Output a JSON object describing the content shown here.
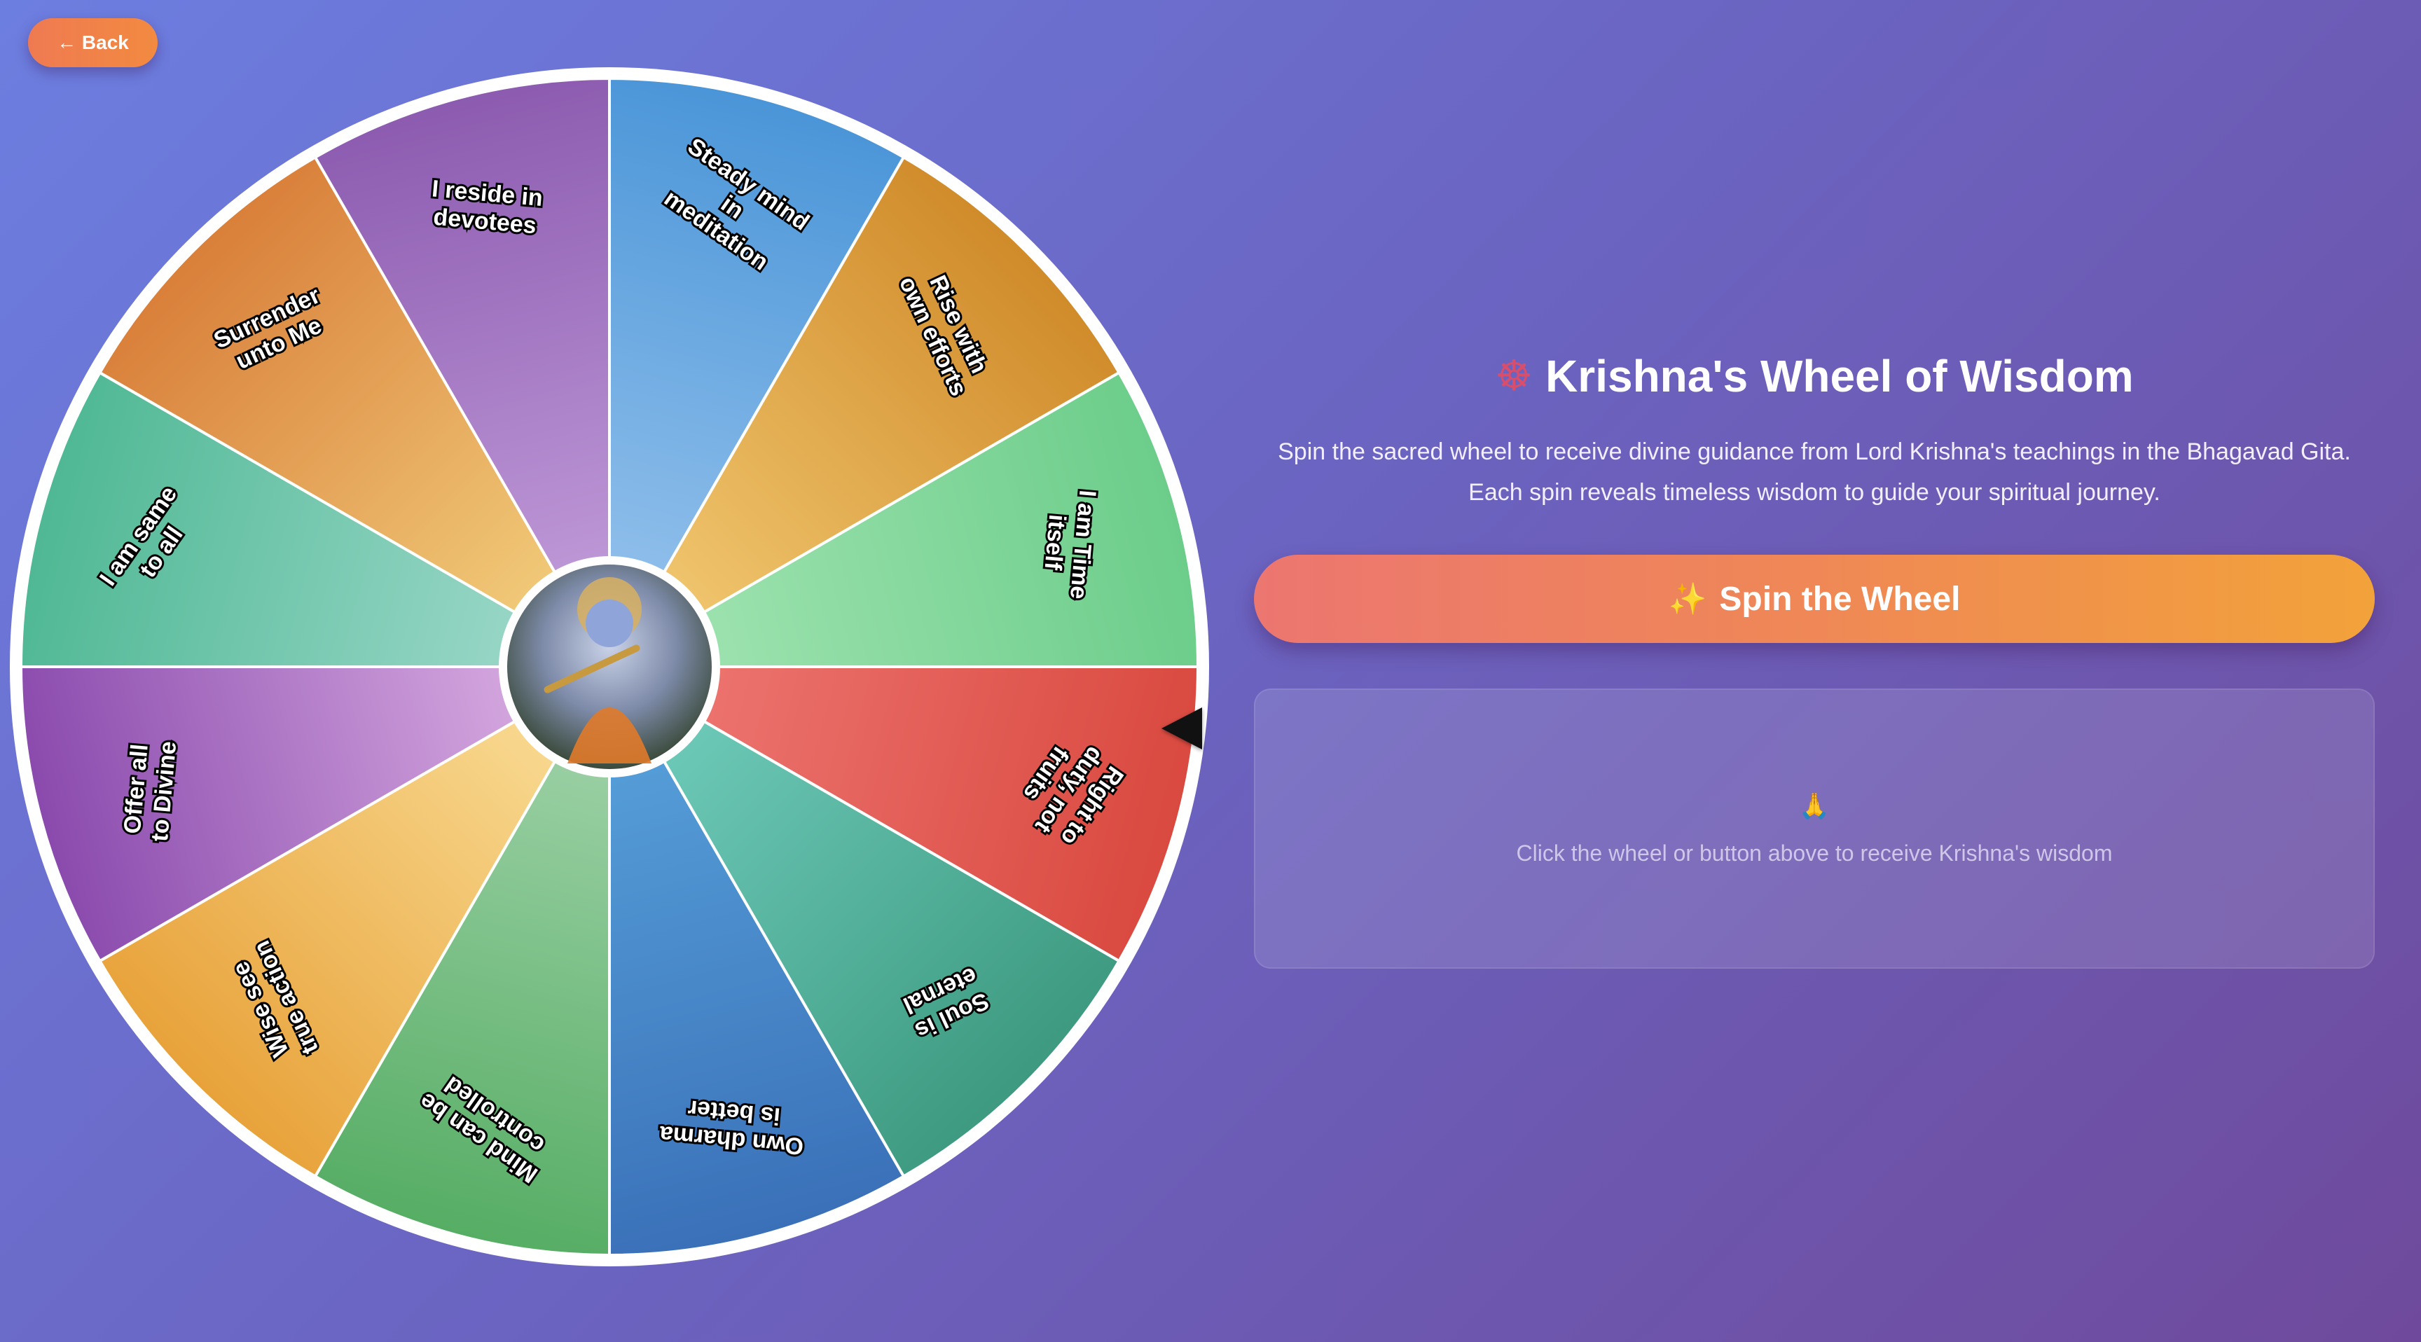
{
  "nav": {
    "back_label": "← Back"
  },
  "wheel": {
    "center_image": "krishna-portrait",
    "segments": [
      {
        "label": "Steady mind in meditation",
        "color_start": "#9cc6ee",
        "color_end": "#4a95d8"
      },
      {
        "label": "Rise with own efforts",
        "color_start": "#f6d07a",
        "color_end": "#d08b2a"
      },
      {
        "label": "I am Time itself",
        "color_start": "#a6e6b6",
        "color_end": "#6ccd8a"
      },
      {
        "label": "Right to duty, not fruits",
        "color_start": "#f07b78",
        "color_end": "#d9493f"
      },
      {
        "label": "Soul is eternal",
        "color_start": "#76d2c2",
        "color_end": "#3d9a80"
      },
      {
        "label": "Own dharma is better",
        "color_start": "#5aa6de",
        "color_end": "#3a70b8"
      },
      {
        "label": "Mind can be controlled",
        "color_start": "#a7d6b0",
        "color_end": "#56ad64"
      },
      {
        "label": "Wise see true action",
        "color_start": "#fbe3a0",
        "color_end": "#e8a23a"
      },
      {
        "label": "Offer all to Divine",
        "color_start": "#e2b8e8",
        "color_end": "#8a4aad"
      },
      {
        "label": "I am same to all",
        "color_start": "#a6dcd0",
        "color_end": "#4fb894"
      },
      {
        "label": "Surrender unto Me",
        "color_start": "#f5d884",
        "color_end": "#d97f3a"
      },
      {
        "label": "I reside in devotees",
        "color_start": "#c7a3de",
        "color_end": "#8c5bb0"
      }
    ]
  },
  "panel": {
    "title_icon": "ferris-wheel-icon",
    "title": "Krishna's Wheel of Wisdom",
    "subtitle_line1": "Spin the sacred wheel to receive divine guidance from Lord Krishna's teachings in the Bhagavad Gita.",
    "subtitle_line2": "Each spin reveals timeless wisdom to guide your spiritual journey.",
    "spin_icon": "sparkles-icon",
    "spin_label": "Spin the Wheel",
    "result_icon": "praying-hands-icon",
    "result_text": "Click the wheel or button above to receive Krishna's wisdom"
  },
  "colors": {
    "background_start": "#6c7ee0",
    "background_end": "#6f4a9c",
    "accent_orange": "#f28a40"
  }
}
